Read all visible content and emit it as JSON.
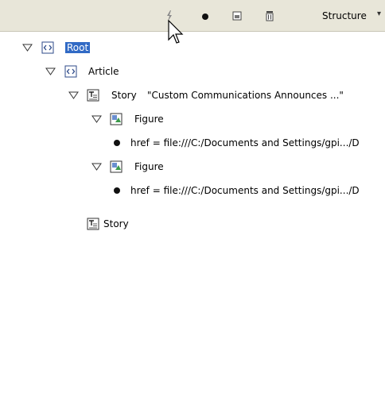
{
  "toolbar": {
    "view_label": "Structure",
    "icons": [
      "lightning-icon",
      "dot-icon",
      "new-element-icon",
      "trash-icon",
      "chevron-down-icon"
    ]
  },
  "tree": {
    "root_label": "Root",
    "article_label": "Article",
    "story1_label": "Story",
    "story1_preview": "\"Custom Communications Announces ...\"",
    "figure1_label": "Figure",
    "attr1_text": "href = file:///C:/Documents and Settings/gpi.../D",
    "figure2_label": "Figure",
    "attr2_text": "href = file:///C:/Documents and Settings/gpi.../D",
    "story2_label": "Story"
  },
  "colors": {
    "selection": "#316ac5",
    "toolbar_bg": "#e8e6d9"
  }
}
